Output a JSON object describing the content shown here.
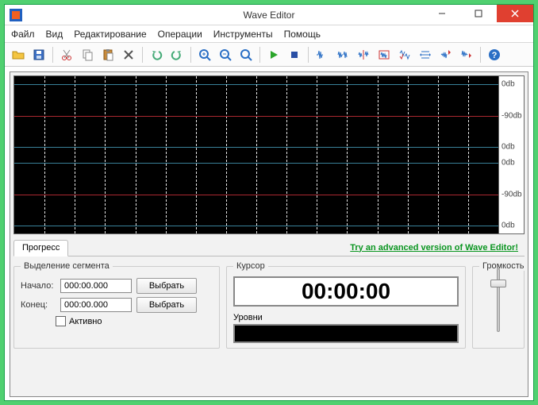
{
  "window": {
    "title": "Wave Editor"
  },
  "menu": {
    "file": "Файл",
    "view": "Вид",
    "edit": "Редактирование",
    "ops": "Операции",
    "tools": "Инструменты",
    "help": "Помощь"
  },
  "toolbar": {
    "open": "open",
    "save": "save",
    "cut": "cut",
    "copy": "copy",
    "paste": "paste",
    "delete": "delete",
    "undo": "undo",
    "redo": "redo",
    "zoomin": "zoom-in",
    "zoomout": "zoom-out",
    "zoomfit": "zoom-fit",
    "play": "play",
    "stop": "stop",
    "fx1": "normalize",
    "fx2": "trim",
    "fx3": "reverse",
    "fx4": "band",
    "fx5": "mix",
    "fx6": "stretch",
    "fx7": "fadein",
    "fx8": "fadeout",
    "helpbtn": "help"
  },
  "db": {
    "0a": "0db",
    "n90a": "-90db",
    "0b": "0db",
    "0c": "0db",
    "n90b": "-90db",
    "0d": "0db"
  },
  "tabs": {
    "progress": "Прогресс"
  },
  "promo": "Try an advanced version of Wave Editor!",
  "segment": {
    "legend": "Выделение сегмента",
    "start_label": "Начало:",
    "end_label": "Конец:",
    "start_value": "000:00.000",
    "end_value": "000:00.000",
    "select_btn": "Выбрать",
    "active_label": "Активно"
  },
  "cursor": {
    "legend": "Курсор",
    "time": "00:00:00",
    "levels_label": "Уровни"
  },
  "volume": {
    "legend": "Громкость"
  }
}
